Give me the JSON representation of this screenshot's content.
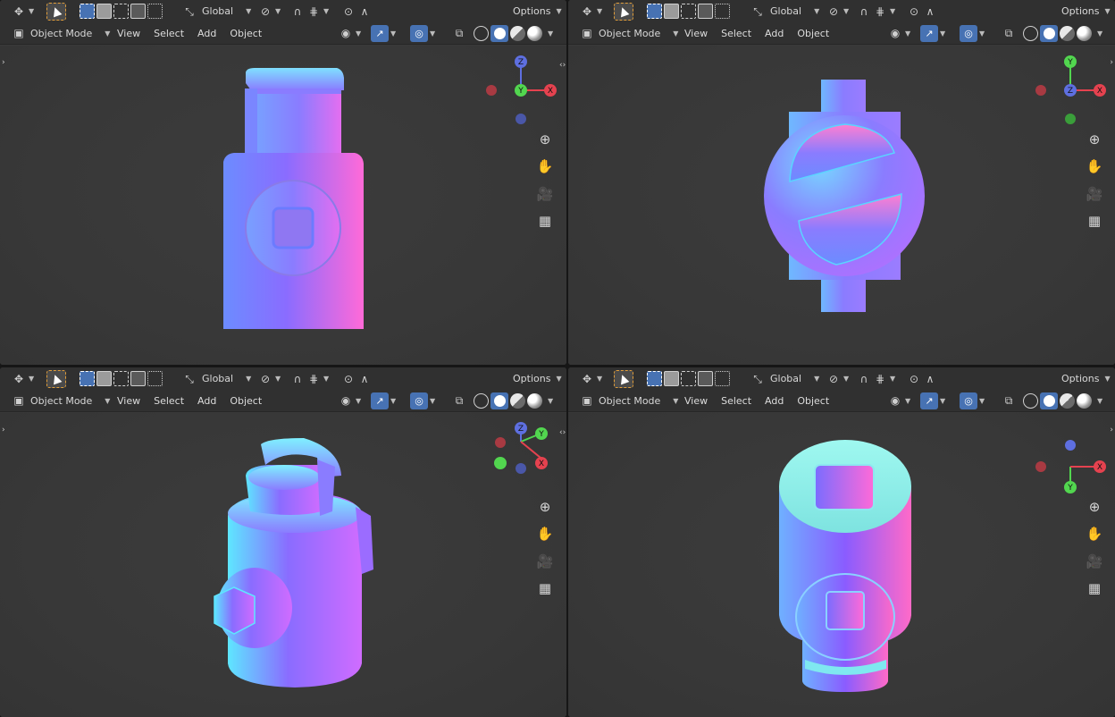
{
  "toolbar": {
    "transform_orientation": "Global",
    "options_label": "Options"
  },
  "header": {
    "mode_label": "Object Mode",
    "menu": [
      "View",
      "Select",
      "Add",
      "Object"
    ]
  },
  "gizmo": {
    "front": {
      "axes": [
        "Z",
        "Y",
        "X"
      ]
    },
    "top": {
      "axes": [
        "Y",
        "Z",
        "X"
      ]
    },
    "persp": {
      "axes": [
        "Z",
        "Y",
        "X"
      ]
    },
    "bottom": {
      "axes": [
        "X",
        "Y"
      ]
    }
  },
  "colors": {
    "x_axis": "#e5424f",
    "y_axis": "#52d64f",
    "z_axis": "#5e6fe0",
    "accent": "#4772b3",
    "active_tool_outline": "#e09d3a"
  },
  "icons": {
    "navigation": [
      "zoom-icon",
      "hand-pan-icon",
      "camera-icon",
      "grid-icon"
    ]
  }
}
